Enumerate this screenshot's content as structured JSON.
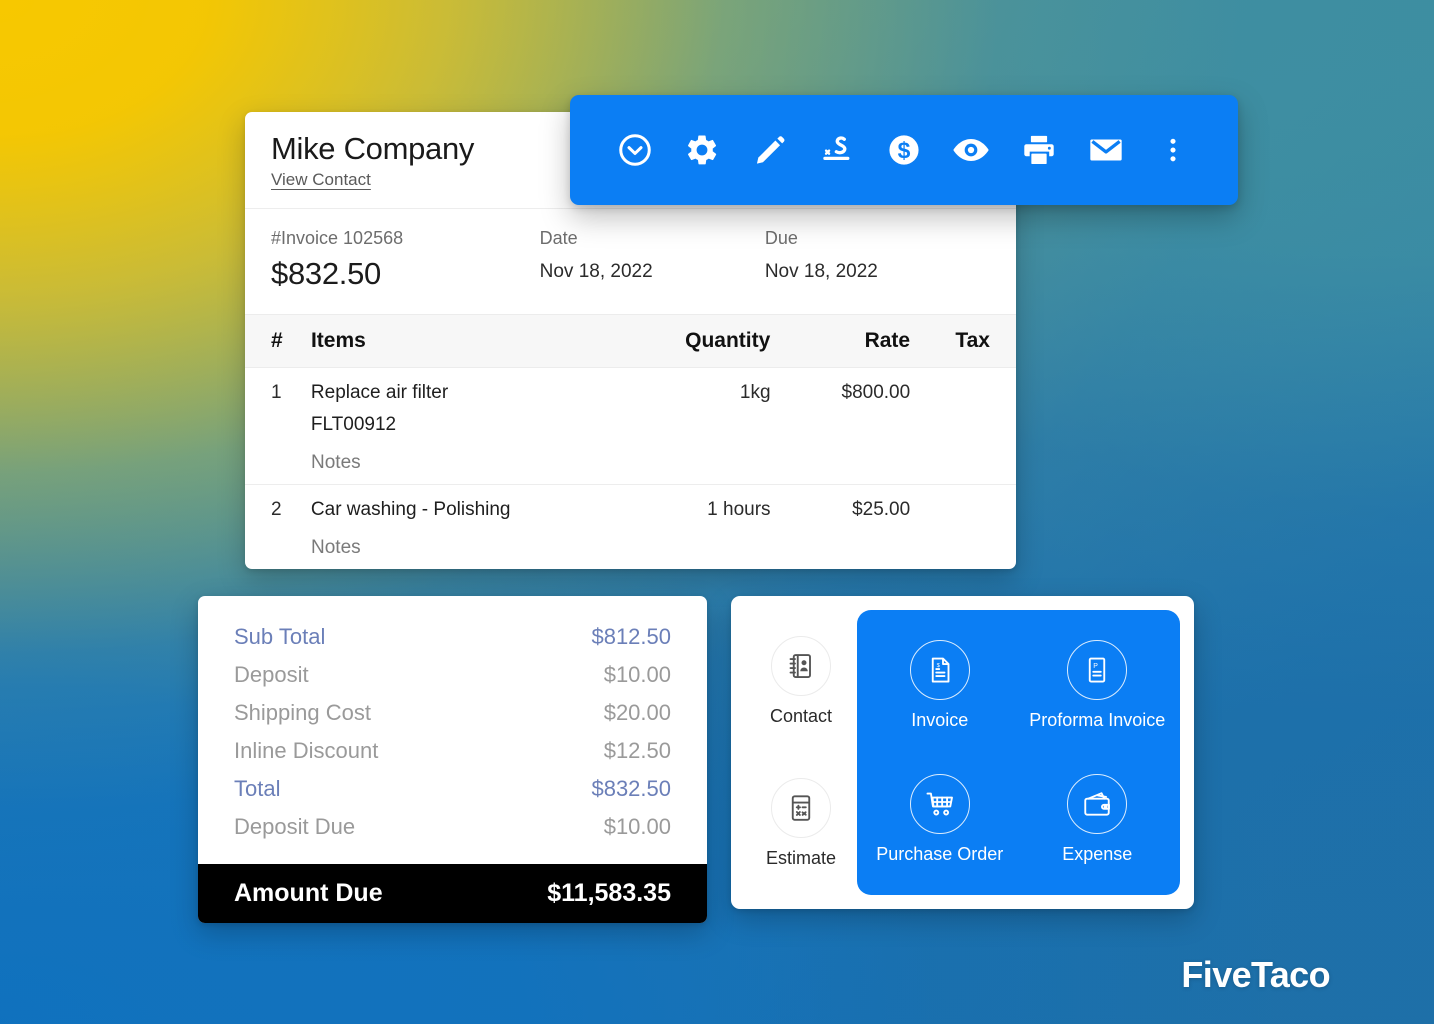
{
  "invoice": {
    "company_name": "Mike Company",
    "view_contact_label": "View Contact",
    "invoice_number_label": "#Invoice 102568",
    "amount": "$832.50",
    "date_label": "Date",
    "date_value": "Nov 18, 2022",
    "due_label": "Due",
    "due_value": "Nov 18, 2022",
    "table": {
      "headers": {
        "num": "#",
        "items": "Items",
        "quantity": "Quantity",
        "rate": "Rate",
        "tax": "Tax"
      },
      "rows": [
        {
          "num": "1",
          "name": "Replace air filter",
          "sku": "FLT00912",
          "notes": "Notes",
          "quantity": "1kg",
          "rate": "$800.00",
          "tax": ""
        },
        {
          "num": "2",
          "name": "Car washing - Polishing",
          "sku": "",
          "notes": "Notes",
          "quantity": "1 hours",
          "rate": "$25.00",
          "tax": ""
        }
      ]
    }
  },
  "toolbar": {
    "accent_color": "#0B7EF4",
    "buttons": [
      {
        "name": "status-chevron-circle-icon",
        "label": "Status"
      },
      {
        "name": "gear-icon",
        "label": "Settings"
      },
      {
        "name": "pencil-icon",
        "label": "Edit"
      },
      {
        "name": "signature-icon",
        "label": "Signature"
      },
      {
        "name": "dollar-circle-icon",
        "label": "Payment"
      },
      {
        "name": "eye-icon",
        "label": "Preview"
      },
      {
        "name": "print-icon",
        "label": "Print"
      },
      {
        "name": "email-icon",
        "label": "Email"
      },
      {
        "name": "more-vertical-icon",
        "label": "More"
      }
    ]
  },
  "totals": {
    "accent_color": "#6B7FB8",
    "rows": [
      {
        "label": "Sub Total",
        "value": "$812.50",
        "accent": true
      },
      {
        "label": "Deposit",
        "value": "$10.00",
        "accent": false
      },
      {
        "label": "Shipping Cost",
        "value": "$20.00",
        "accent": false
      },
      {
        "label": "Inline Discount",
        "value": "$12.50",
        "accent": false
      },
      {
        "label": "Total",
        "value": "$832.50",
        "accent": true
      },
      {
        "label": "Deposit Due",
        "value": "$10.00",
        "accent": false
      }
    ],
    "amount_due_label": "Amount Due",
    "amount_due_value": "$11,583.35"
  },
  "actions": {
    "highlight_color": "#0B7EF4",
    "left": [
      {
        "label": "Contact",
        "icon": "address-book-icon"
      },
      {
        "label": "Estimate",
        "icon": "calculator-icon"
      }
    ],
    "right": [
      {
        "label": "Invoice",
        "icon": "invoice-document-icon"
      },
      {
        "label": "Proforma Invoice",
        "icon": "proforma-document-icon"
      },
      {
        "label": "Purchase Order",
        "icon": "shopping-cart-icon"
      },
      {
        "label": "Expense",
        "icon": "wallet-icon"
      }
    ]
  },
  "branding": {
    "watermark": "FiveTaco"
  }
}
